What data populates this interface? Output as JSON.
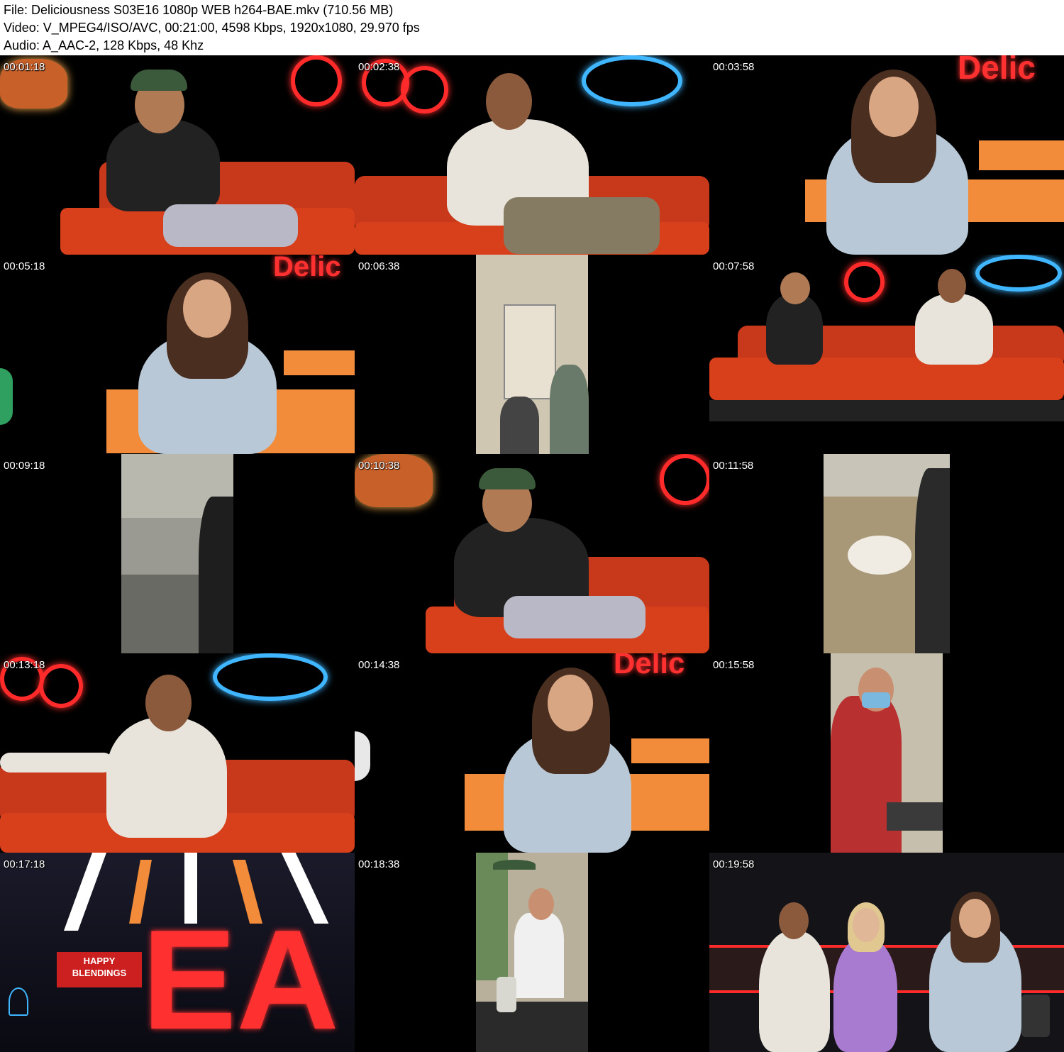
{
  "header": {
    "file_line": "File: Deliciousness S03E16 1080p WEB h264-BAE.mkv (710.56 MB)",
    "video_line": "Video: V_MPEG4/ISO/AVC, 00:21:00, 4598 Kbps, 1920x1080, 29.970 fps",
    "audio_line": "Audio: A_AAC-2, 128 Kbps, 48 Khz"
  },
  "thumbnails": [
    {
      "timestamp": "00:01:18"
    },
    {
      "timestamp": "00:02:38"
    },
    {
      "timestamp": "00:03:58"
    },
    {
      "timestamp": "00:05:18"
    },
    {
      "timestamp": "00:06:38"
    },
    {
      "timestamp": "00:07:58"
    },
    {
      "timestamp": "00:09:18"
    },
    {
      "timestamp": "00:10:38"
    },
    {
      "timestamp": "00:11:58"
    },
    {
      "timestamp": "00:13:18"
    },
    {
      "timestamp": "00:14:38"
    },
    {
      "timestamp": "00:15:58"
    },
    {
      "timestamp": "00:17:18"
    },
    {
      "timestamp": "00:18:38"
    },
    {
      "timestamp": "00:19:58"
    }
  ],
  "signage": {
    "delic": "Delic",
    "happy": "HAPPY",
    "blendings": "BLENDINGS",
    "ea": "EA"
  },
  "colors": {
    "sofa": "#d8401c",
    "neon_red": "#ff2a2a",
    "neon_blue": "#3fb6ff",
    "background": "#000000"
  }
}
